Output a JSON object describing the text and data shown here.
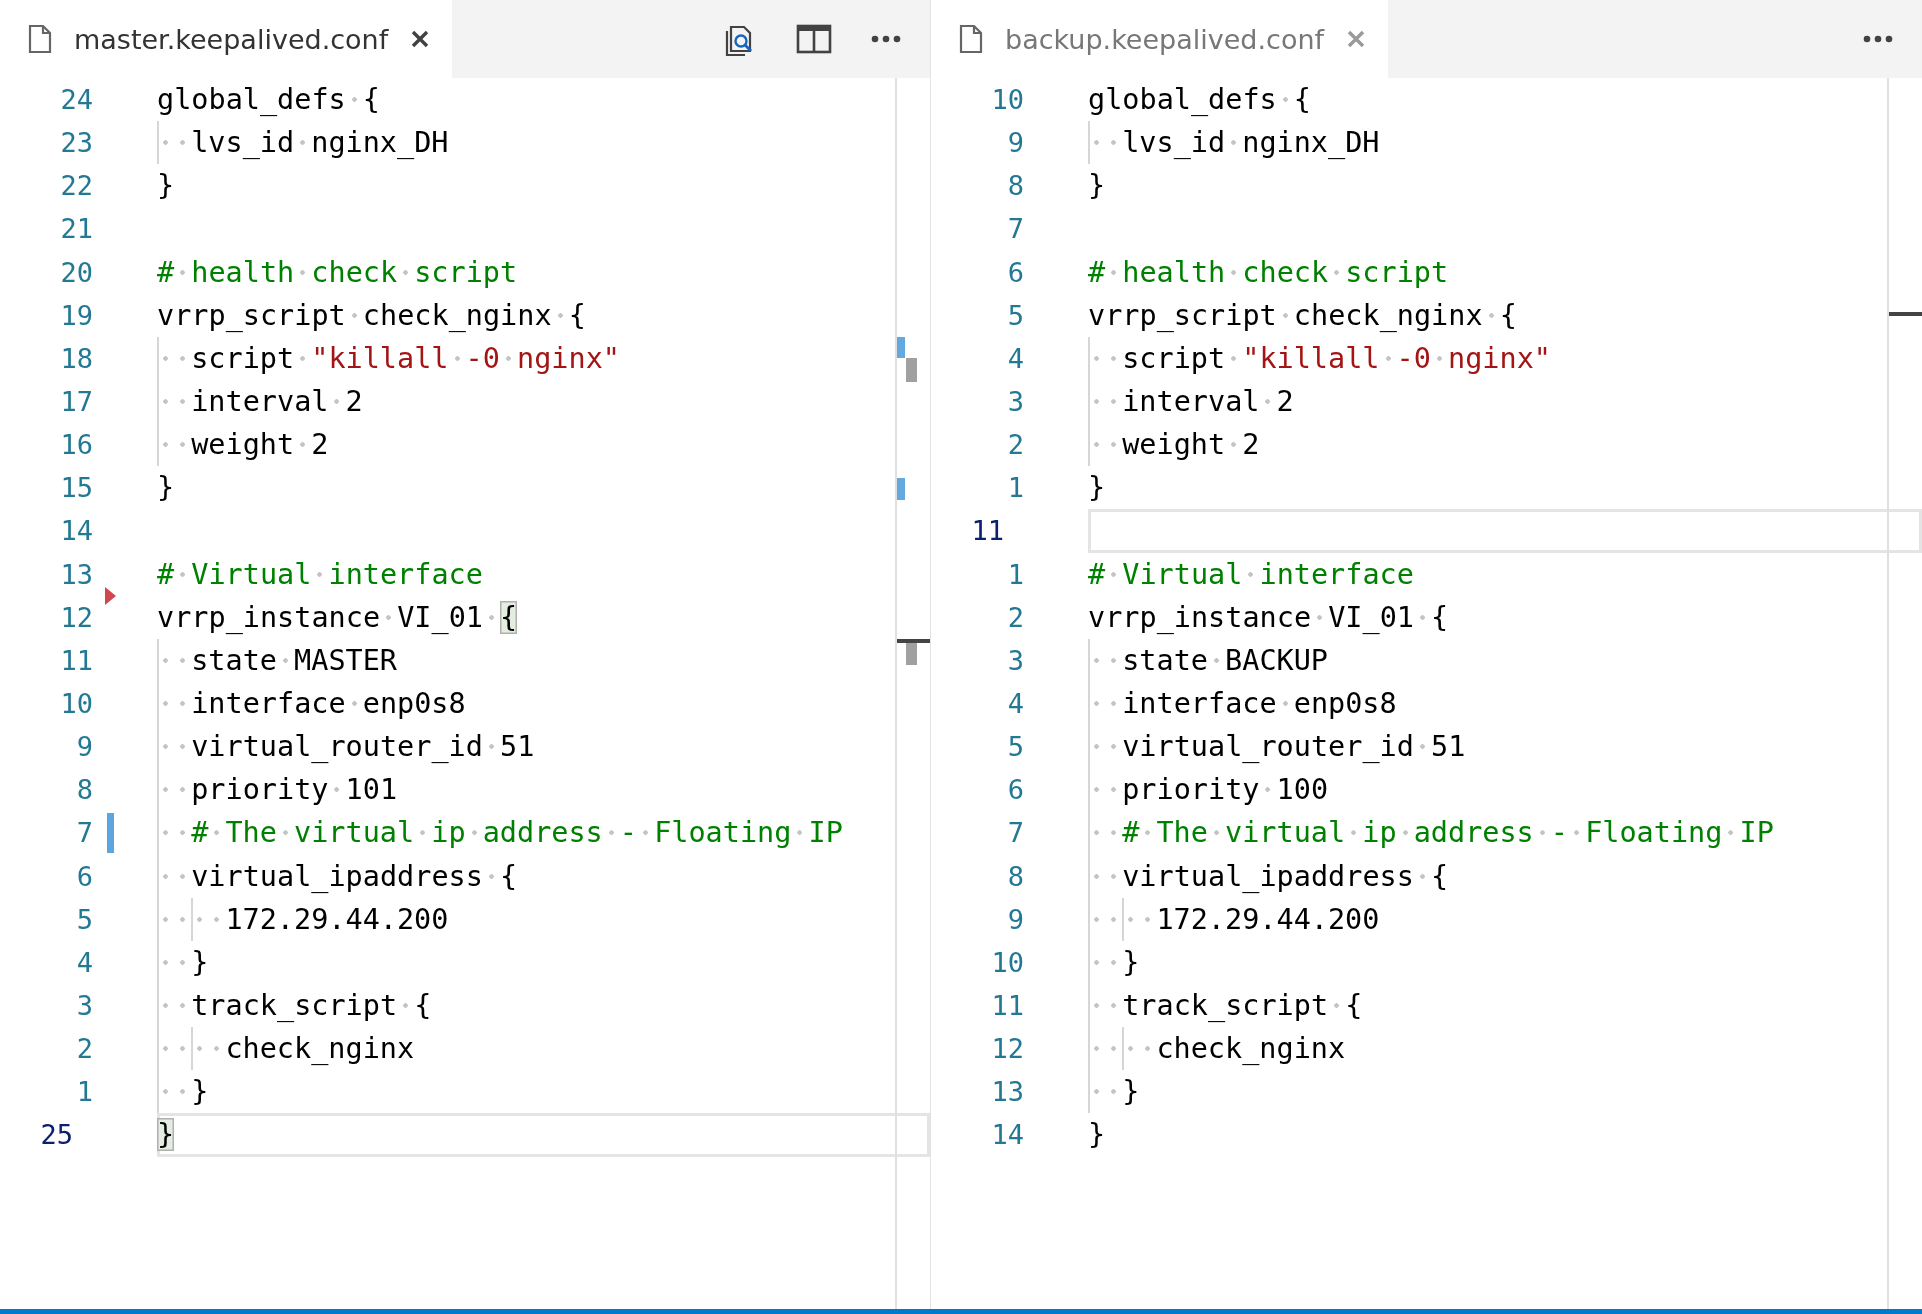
{
  "panes": [
    {
      "focused": true,
      "tab": {
        "label": "master.keepalived.conf",
        "selected": true
      },
      "actions": [
        {
          "kind": "open-preview"
        },
        {
          "kind": "split-editor"
        },
        {
          "kind": "more"
        }
      ],
      "lines": [
        {
          "number": "24",
          "current": false,
          "modified": false,
          "deleted_before": false,
          "tokens": [
            {
              "text": "global_defs {",
              "kind": "plain"
            }
          ]
        },
        {
          "number": "23",
          "current": false,
          "modified": false,
          "deleted_before": false,
          "tokens": [
            {
              "text": "  lvs_id nginx_DH",
              "kind": "plain"
            }
          ]
        },
        {
          "number": "22",
          "current": false,
          "modified": false,
          "deleted_before": false,
          "tokens": [
            {
              "text": "}",
              "kind": "plain"
            }
          ]
        },
        {
          "number": "21",
          "current": false,
          "modified": false,
          "deleted_before": false
        },
        {
          "number": "20",
          "current": false,
          "modified": false,
          "deleted_before": false,
          "tokens": [
            {
              "text": "# health check script",
              "kind": "comment"
            }
          ]
        },
        {
          "number": "19",
          "current": false,
          "modified": false,
          "deleted_before": false,
          "tokens": [
            {
              "text": "vrrp_script check_nginx {",
              "kind": "plain"
            }
          ]
        },
        {
          "number": "18",
          "current": false,
          "modified": false,
          "deleted_before": false,
          "tokens": [
            {
              "text": "  script ",
              "kind": "plain"
            },
            {
              "text": "\"killall -0 nginx\"",
              "kind": "string"
            }
          ]
        },
        {
          "number": "17",
          "current": false,
          "modified": false,
          "deleted_before": false,
          "tokens": [
            {
              "text": "  interval 2",
              "kind": "plain"
            }
          ]
        },
        {
          "number": "16",
          "current": false,
          "modified": false,
          "deleted_before": false,
          "tokens": [
            {
              "text": "  weight 2",
              "kind": "plain"
            }
          ]
        },
        {
          "number": "15",
          "current": false,
          "modified": false,
          "deleted_before": false,
          "tokens": [
            {
              "text": "}",
              "kind": "plain"
            }
          ]
        },
        {
          "number": "14",
          "current": false,
          "modified": false,
          "deleted_before": false
        },
        {
          "number": "13",
          "current": false,
          "modified": false,
          "deleted_before": false,
          "tokens": [
            {
              "text": "# Virtual interface",
              "kind": "comment"
            }
          ]
        },
        {
          "number": "12",
          "current": false,
          "modified": false,
          "deleted_before": true,
          "tokens": [
            {
              "text": "vrrp_instance VI_01 ",
              "kind": "plain"
            },
            {
              "text": "{",
              "kind": "bracket"
            }
          ]
        },
        {
          "number": "11",
          "current": false,
          "modified": false,
          "deleted_before": false,
          "tokens": [
            {
              "text": "  state MASTER",
              "kind": "plain"
            }
          ]
        },
        {
          "number": "10",
          "current": false,
          "modified": false,
          "deleted_before": false,
          "tokens": [
            {
              "text": "  interface enp0s8",
              "kind": "plain"
            }
          ]
        },
        {
          "number": "9",
          "current": false,
          "modified": false,
          "deleted_before": false,
          "tokens": [
            {
              "text": "  virtual_router_id 51",
              "kind": "plain"
            }
          ]
        },
        {
          "number": "8",
          "current": false,
          "modified": false,
          "deleted_before": false,
          "tokens": [
            {
              "text": "  priority 101",
              "kind": "plain"
            }
          ]
        },
        {
          "number": "7",
          "current": false,
          "modified": true,
          "deleted_before": false,
          "tokens": [
            {
              "text": "  # The virtual ip address - Floating IP",
              "kind": "comment"
            }
          ]
        },
        {
          "number": "6",
          "current": false,
          "modified": false,
          "deleted_before": false,
          "tokens": [
            {
              "text": "  virtual_ipaddress {",
              "kind": "plain"
            }
          ]
        },
        {
          "number": "5",
          "current": false,
          "modified": false,
          "deleted_before": false,
          "tokens": [
            {
              "text": "    172.29.44.200",
              "kind": "plain"
            }
          ]
        },
        {
          "number": "4",
          "current": false,
          "modified": false,
          "deleted_before": false,
          "tokens": [
            {
              "text": "  }",
              "kind": "plain"
            }
          ]
        },
        {
          "number": "3",
          "current": false,
          "modified": false,
          "deleted_before": false,
          "tokens": [
            {
              "text": "  track_script {",
              "kind": "plain"
            }
          ]
        },
        {
          "number": "2",
          "current": false,
          "modified": false,
          "deleted_before": false,
          "tokens": [
            {
              "text": "    check_nginx",
              "kind": "plain"
            }
          ]
        },
        {
          "number": "1",
          "current": false,
          "modified": false,
          "deleted_before": false,
          "tokens": [
            {
              "text": "  }",
              "kind": "plain"
            }
          ]
        },
        {
          "number": "25",
          "current": true,
          "modified": false,
          "deleted_before": false,
          "tokens": [
            {
              "text": "}",
              "kind": "bracket"
            }
          ]
        }
      ]
    },
    {
      "focused": false,
      "tab": {
        "label": "backup.keepalived.conf",
        "selected": true
      },
      "actions": [
        {
          "kind": "more"
        }
      ],
      "lines": [
        {
          "number": "10",
          "current": false,
          "tokens": [
            {
              "text": "global_defs {",
              "kind": "plain"
            }
          ]
        },
        {
          "number": "9",
          "current": false,
          "tokens": [
            {
              "text": "  lvs_id nginx_DH",
              "kind": "plain"
            }
          ]
        },
        {
          "number": "8",
          "current": false,
          "tokens": [
            {
              "text": "}",
              "kind": "plain"
            }
          ]
        },
        {
          "number": "7",
          "current": false
        },
        {
          "number": "6",
          "current": false,
          "tokens": [
            {
              "text": "# health check script",
              "kind": "comment"
            }
          ]
        },
        {
          "number": "5",
          "current": false,
          "tokens": [
            {
              "text": "vrrp_script check_nginx {",
              "kind": "plain"
            }
          ]
        },
        {
          "number": "4",
          "current": false,
          "tokens": [
            {
              "text": "  script ",
              "kind": "plain"
            },
            {
              "text": "\"killall -0 nginx\"",
              "kind": "string"
            }
          ]
        },
        {
          "number": "3",
          "current": false,
          "tokens": [
            {
              "text": "  interval 2",
              "kind": "plain"
            }
          ]
        },
        {
          "number": "2",
          "current": false,
          "tokens": [
            {
              "text": "  weight 2",
              "kind": "plain"
            }
          ]
        },
        {
          "number": "1",
          "current": false,
          "tokens": [
            {
              "text": "}",
              "kind": "plain"
            }
          ]
        },
        {
          "number": "11",
          "current": true
        },
        {
          "number": "1",
          "current": false,
          "tokens": [
            {
              "text": "# Virtual interface",
              "kind": "comment"
            }
          ]
        },
        {
          "number": "2",
          "current": false,
          "tokens": [
            {
              "text": "vrrp_instance VI_01 {",
              "kind": "plain"
            }
          ]
        },
        {
          "number": "3",
          "current": false,
          "tokens": [
            {
              "text": "  state BACKUP",
              "kind": "plain"
            }
          ]
        },
        {
          "number": "4",
          "current": false,
          "tokens": [
            {
              "text": "  interface enp0s8",
              "kind": "plain"
            }
          ]
        },
        {
          "number": "5",
          "current": false,
          "tokens": [
            {
              "text": "  virtual_router_id 51",
              "kind": "plain"
            }
          ]
        },
        {
          "number": "6",
          "current": false,
          "tokens": [
            {
              "text": "  priority 100",
              "kind": "plain"
            }
          ]
        },
        {
          "number": "7",
          "current": false,
          "tokens": [
            {
              "text": "  # The virtual ip address - Floating IP",
              "kind": "comment"
            }
          ]
        },
        {
          "number": "8",
          "current": false,
          "tokens": [
            {
              "text": "  virtual_ipaddress {",
              "kind": "plain"
            }
          ]
        },
        {
          "number": "9",
          "current": false,
          "tokens": [
            {
              "text": "    172.29.44.200",
              "kind": "plain"
            }
          ]
        },
        {
          "number": "10",
          "current": false,
          "tokens": [
            {
              "text": "  }",
              "kind": "plain"
            }
          ]
        },
        {
          "number": "11",
          "current": false,
          "tokens": [
            {
              "text": "  track_script {",
              "kind": "plain"
            }
          ]
        },
        {
          "number": "12",
          "current": false,
          "tokens": [
            {
              "text": "    check_nginx",
              "kind": "plain"
            }
          ]
        },
        {
          "number": "13",
          "current": false,
          "tokens": [
            {
              "text": "  }",
              "kind": "plain"
            }
          ]
        },
        {
          "number": "14",
          "current": false,
          "tokens": [
            {
              "text": "}",
              "kind": "plain"
            }
          ]
        }
      ]
    }
  ]
}
